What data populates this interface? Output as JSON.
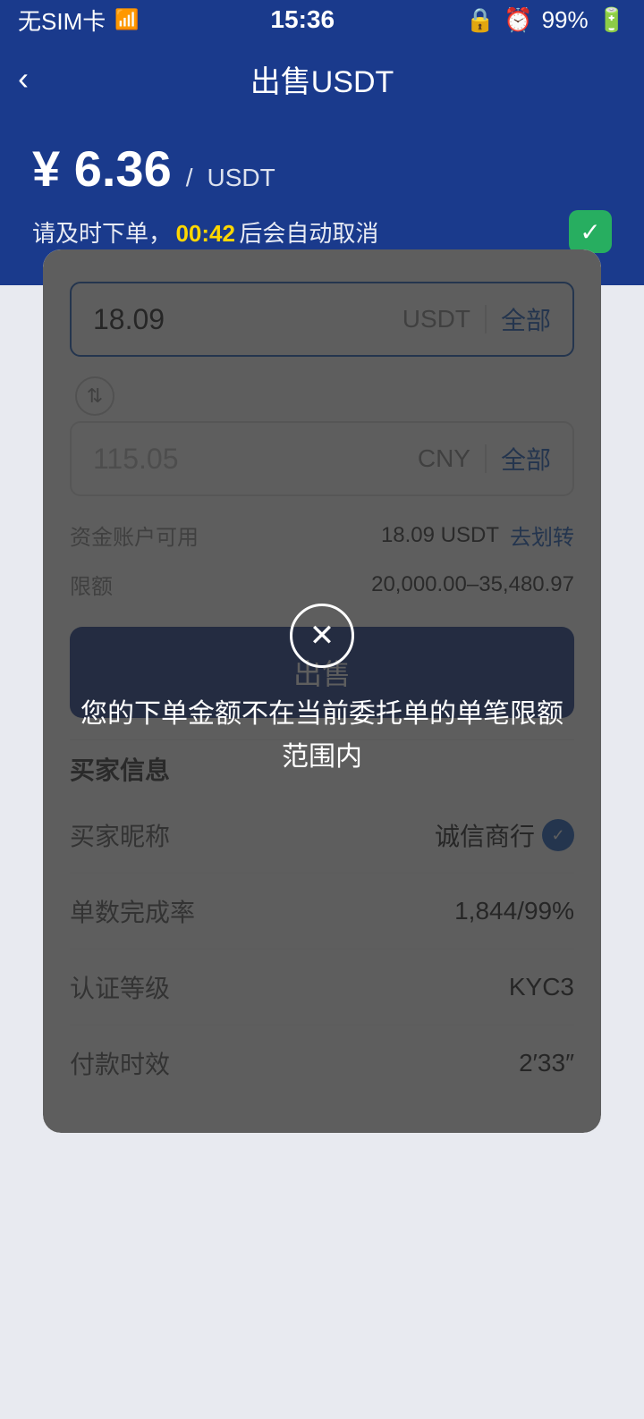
{
  "statusBar": {
    "simText": "无SIM卡",
    "wifiIcon": "wifi",
    "time": "15:36",
    "lockIcon": "🔒",
    "alarmIcon": "⏰",
    "batteryText": "99%"
  },
  "header": {
    "backLabel": "‹",
    "title": "出售USDT"
  },
  "priceSection": {
    "currencySymbol": "¥",
    "price": "6.36",
    "separator": "/",
    "unit": "USDT",
    "promptText": "请及时下单，",
    "countdown": "00:42",
    "afterCountdown": "后会自动取消"
  },
  "inputSection": {
    "usdt": {
      "value": "18.09",
      "currency": "USDT",
      "allLabel": "全部"
    },
    "cny": {
      "value": "115.05",
      "currency": "CNY",
      "allLabel": "全部"
    }
  },
  "infoSection": {
    "availableLabel": "资金账户可用",
    "availableValue": "18.09 USDT",
    "transferLabel": "去划转",
    "limitLabel": "限额",
    "limitValue": "20,000.00–35,480.97"
  },
  "sellButton": {
    "label": "出售"
  },
  "buyerSection": {
    "title": "买家信息",
    "rows": [
      {
        "label": "买家昵称",
        "value": "诚信商行",
        "hasVerified": true
      },
      {
        "label": "单数完成率",
        "value": "1,844/99%",
        "hasVerified": false
      },
      {
        "label": "认证等级",
        "value": "KYC3",
        "hasVerified": false
      },
      {
        "label": "付款时效",
        "value": "2′33″",
        "hasVerified": false
      }
    ]
  },
  "overlay": {
    "message": "您的下单金额不在当前委托单的单笔限额范围内",
    "closeIcon": "✕"
  }
}
